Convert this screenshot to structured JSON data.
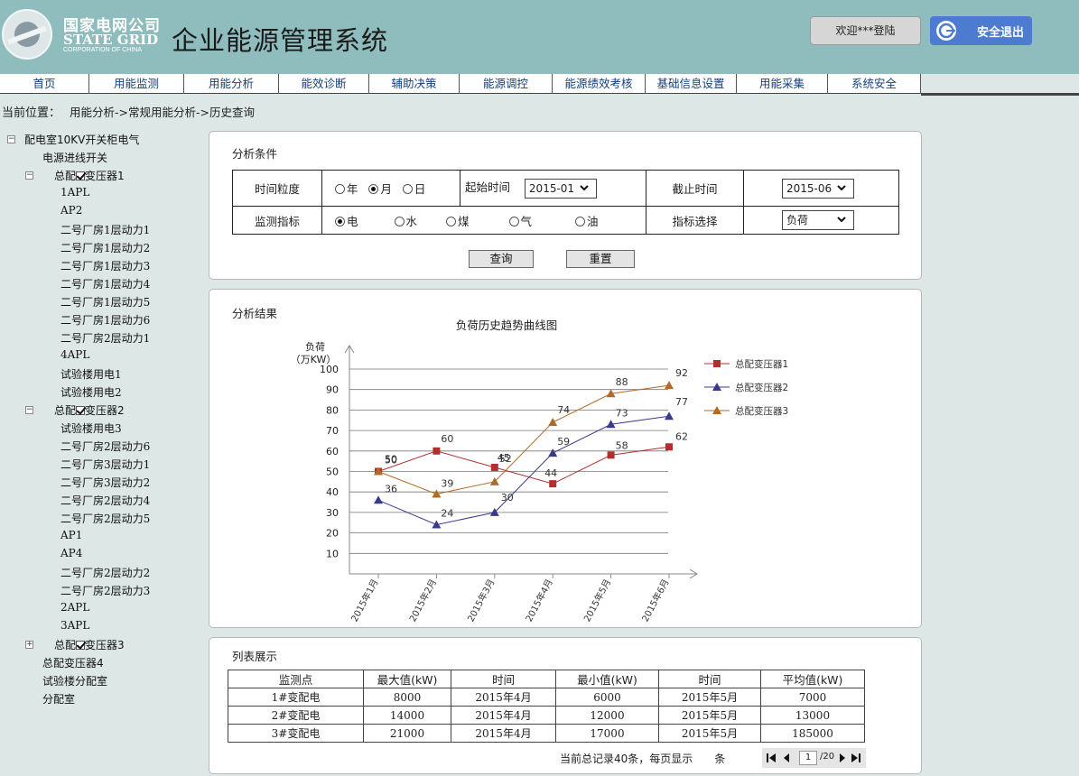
{
  "header": {
    "logo_cn": "国家电网公司",
    "logo_en": "STATE GRID",
    "logo_en_sub": "CORPORATION OF CHINA",
    "system_title": "企业能源管理系统",
    "welcome_label": "欢迎***登陆",
    "logout_label": "安全退出"
  },
  "nav": {
    "items": [
      "首页",
      "用能监测",
      "用能分析",
      "能效诊断",
      "辅助决策",
      "能源调控",
      "能源绩效考核",
      "基础信息设置",
      "用能采集",
      "系统安全"
    ]
  },
  "breadcrumb": {
    "label": "当前位置：",
    "path": "用能分析->常规用能分析->历史查询"
  },
  "tree": {
    "root": "配电室10KV开关柜电气",
    "source": "电源进线开关",
    "group1": {
      "name_a": "总配",
      "name_b": "变压器1",
      "children": [
        "1APL",
        "AP2",
        "二号厂房1层动力1",
        "二号厂房1层动力2",
        "二号厂房1层动力3",
        "二号厂房1层动力4",
        "二号厂房1层动力5",
        "二号厂房1层动力6",
        "二号厂房2层动力1",
        "4APL",
        "试验楼用电1",
        "试验楼用电2"
      ]
    },
    "group2": {
      "name_a": "总配",
      "name_b": "变压器2",
      "children": [
        "试验楼用电3",
        "二号厂房2层动力6",
        "二号厂房3层动力1",
        "二号厂房3层动力2",
        "二号厂房2层动力4",
        "二号厂房2层动力5",
        "AP1",
        "AP4",
        "二号厂房2层动力2",
        "二号厂房2层动力3",
        "2APL",
        "3APL"
      ]
    },
    "group3": {
      "name_a": "总配",
      "name_b": "变压器3"
    },
    "extra": [
      "总配变压器4",
      "试验楼分配室",
      "分配室"
    ]
  },
  "conditions": {
    "title": "分析条件",
    "granularity_label": "时间粒度",
    "granularity_options": [
      "年",
      "月",
      "日"
    ],
    "granularity_selected": "月",
    "start_label": "起始时间",
    "start_value": "2015-01",
    "end_label": "截止时间",
    "end_value": "2015-06",
    "metric_label": "监测指标",
    "metric_options": [
      "电",
      "水",
      "煤",
      "气",
      "油"
    ],
    "metric_selected": "电",
    "indicator_label": "指标选择",
    "indicator_value": "负荷",
    "query_label": "查询",
    "reset_label": "重置"
  },
  "result": {
    "title": "分析结果"
  },
  "chart_data": {
    "type": "line",
    "title": "负荷历史趋势曲线图",
    "ylabel_line1": "负荷",
    "ylabel_line2": "（万KW）",
    "xlabel": "",
    "categories": [
      "2015年1月",
      "2015年2月",
      "2015年3月",
      "2015年4月",
      "2015年5月",
      "2015年6月"
    ],
    "yticks": [
      10,
      20,
      30,
      40,
      50,
      60,
      70,
      80,
      90,
      100
    ],
    "ylim": [
      0,
      100
    ],
    "grid": true,
    "legend": "right",
    "series": [
      {
        "name": "总配变压器1",
        "values": [
          50,
          60,
          52,
          44,
          58,
          62
        ],
        "color": "#b03030",
        "marker": "square"
      },
      {
        "name": "总配变压器2",
        "values": [
          36,
          24,
          30,
          59,
          73,
          77
        ],
        "color": "#3a3a8c",
        "marker": "triangle"
      },
      {
        "name": "总配变压器3",
        "values": [
          50,
          39,
          45,
          74,
          88,
          92
        ],
        "color": "#b06a2c",
        "marker": "triangle"
      }
    ]
  },
  "list": {
    "title": "列表展示",
    "columns": [
      "监测点",
      "最大值(kW)",
      "时间",
      "最小值(kW)",
      "时间",
      "平均值(kW)"
    ],
    "rows": [
      [
        "1#变配电",
        "8000",
        "2015年4月",
        "6000",
        "2015年5月",
        "7000"
      ],
      [
        "2#变配电",
        "14000",
        "2015年4月",
        "12000",
        "2015年5月",
        "13000"
      ],
      [
        "3#变配电",
        "21000",
        "2015年4月",
        "17000",
        "2015年5月",
        "185000"
      ]
    ],
    "pager_text": "当前总记录40条，每页显示　　条",
    "page_current": "1",
    "page_total": "/20"
  },
  "colors": {
    "header_bg": "#8fbcbd",
    "page_bg": "#dde7e6",
    "nav_text": "#15407a",
    "logout_bg": "#4c7bd0"
  }
}
